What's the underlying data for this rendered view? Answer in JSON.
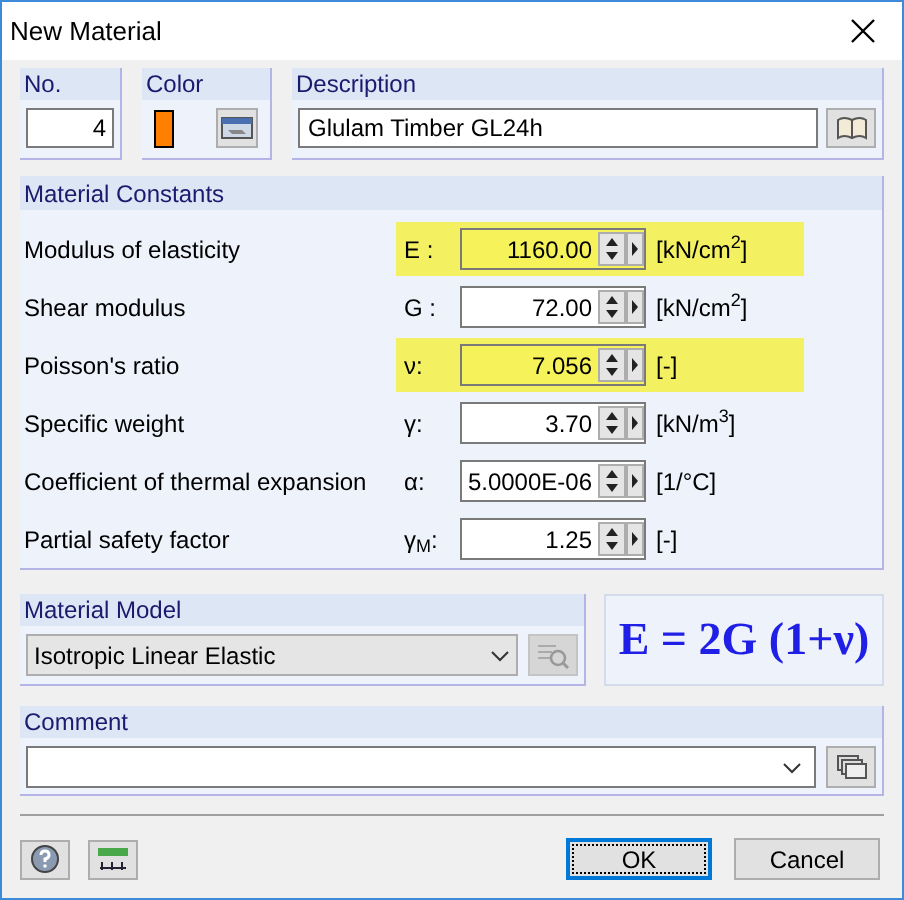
{
  "window": {
    "title": "New Material"
  },
  "number": {
    "label": "No.",
    "value": "4"
  },
  "color": {
    "label": "Color",
    "color": "#ff8000"
  },
  "description": {
    "label": "Description",
    "value": "Glulam Timber GL24h"
  },
  "constants": {
    "title": "Material Constants",
    "rows": [
      {
        "label": "Modulus of elasticity",
        "symbol": "E :",
        "value": "1160.00",
        "unit": "[kN/cm$^{2}$]",
        "highlighted": true
      },
      {
        "label": "Shear modulus",
        "symbol": "G :",
        "value": "72.00",
        "unit": "[kN/cm$^{2}$]",
        "highlighted": false
      },
      {
        "label": "Poisson's ratio",
        "symbol": "ν:",
        "value": "7.056",
        "unit": "[-]",
        "highlighted": true
      },
      {
        "label": "Specific weight",
        "symbol": "γ:",
        "value": "3.70",
        "unit": "[kN/m$^{3}$]",
        "highlighted": false
      },
      {
        "label": "Coefficient of thermal expansion",
        "symbol": "α:",
        "value": "5.0000E-06",
        "unit": "[1/°C]",
        "highlighted": false
      },
      {
        "label": "Partial safety factor",
        "symbol": "γ$_{M}$:",
        "value": "1.25",
        "unit": "[-]",
        "highlighted": false
      }
    ]
  },
  "material_model": {
    "label": "Material Model",
    "value": "Isotropic Linear Elastic"
  },
  "formula": "E = 2G (1+ν)",
  "comment": {
    "label": "Comment"
  },
  "buttons": [
    {
      "label": "OK",
      "default": true
    },
    {
      "label": "Cancel",
      "default": false
    }
  ]
}
